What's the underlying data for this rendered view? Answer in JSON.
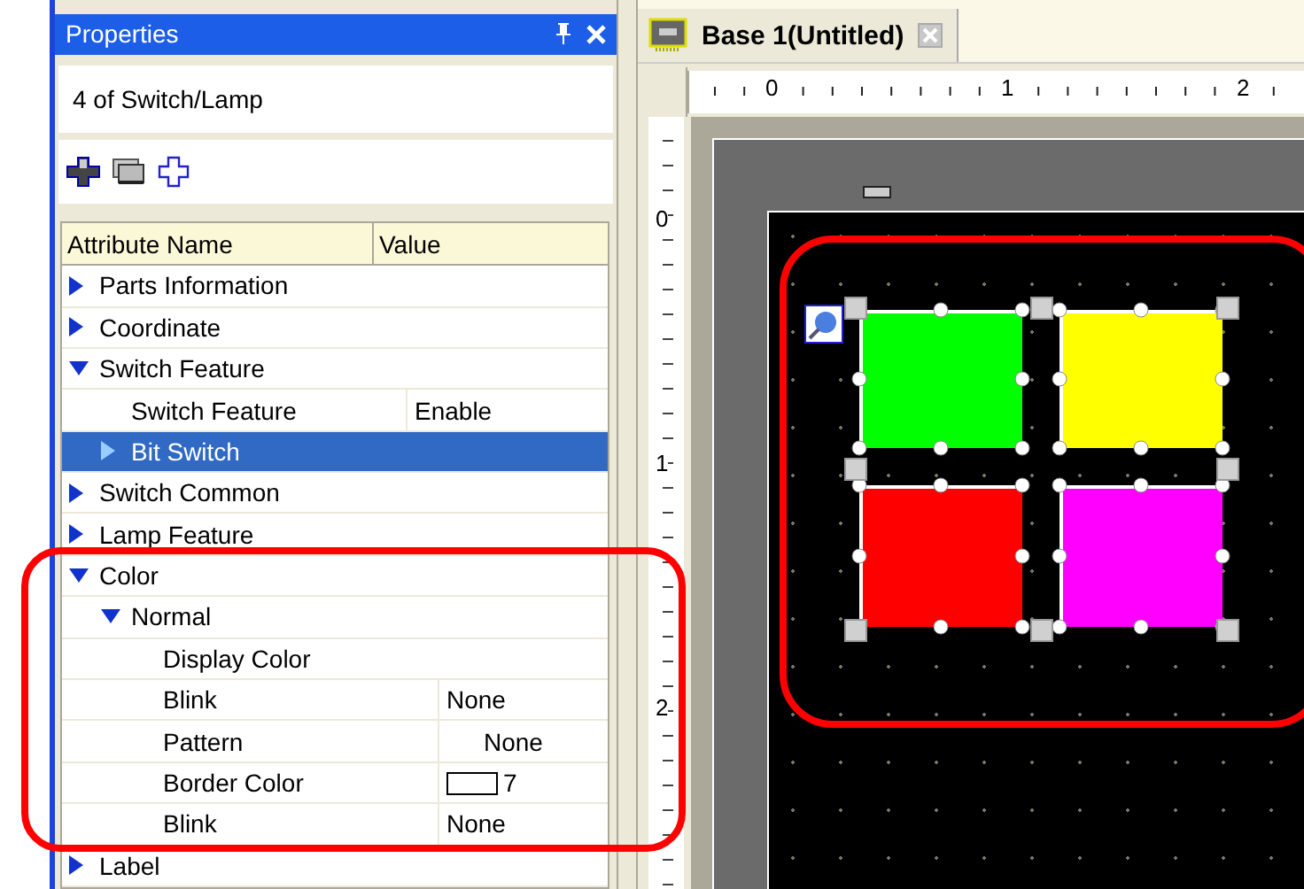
{
  "panel": {
    "title": "Properties",
    "selection": "4 of Switch/Lamp",
    "columns": [
      "Attribute Name",
      "Value"
    ],
    "items": [
      {
        "label": "Parts Information",
        "expanded": false,
        "selected": false
      },
      {
        "label": "Coordinate",
        "expanded": false,
        "selected": false
      },
      {
        "label": "Switch Feature",
        "expanded": true,
        "selected": false,
        "children": [
          {
            "label": "Switch Feature",
            "value": "Enable",
            "selected": false
          },
          {
            "label": "Bit Switch",
            "expanded": false,
            "selected": true
          }
        ]
      },
      {
        "label": "Switch Common",
        "expanded": false,
        "selected": false
      },
      {
        "label": "Lamp Feature",
        "expanded": false,
        "selected": false
      },
      {
        "label": "Color",
        "expanded": true,
        "selected": false,
        "children": [
          {
            "label": "Normal",
            "expanded": true,
            "selected": false,
            "children": [
              {
                "label": "Display Color",
                "selected": false
              },
              {
                "label": "Blink",
                "value": "None",
                "selected": false
              },
              {
                "label": "Pattern",
                "value": "None",
                "selected": false,
                "kind": "offset"
              },
              {
                "label": "Border Color",
                "value": "7",
                "selected": false,
                "kind": "swatch"
              },
              {
                "label": "Blink",
                "value": "None",
                "selected": false
              }
            ]
          }
        ]
      },
      {
        "label": "Label",
        "expanded": false,
        "selected": false
      }
    ]
  },
  "editor": {
    "tab": {
      "title": "Base 1(Untitled)"
    },
    "ruler_h": [
      "0",
      "1",
      "2"
    ],
    "ruler_v": [
      "0",
      "1",
      "2"
    ],
    "parts": [
      {
        "color": "#00ff00"
      },
      {
        "color": "#ffff00"
      },
      {
        "color": "#ff0000"
      },
      {
        "color": "#ff00ff"
      }
    ]
  }
}
